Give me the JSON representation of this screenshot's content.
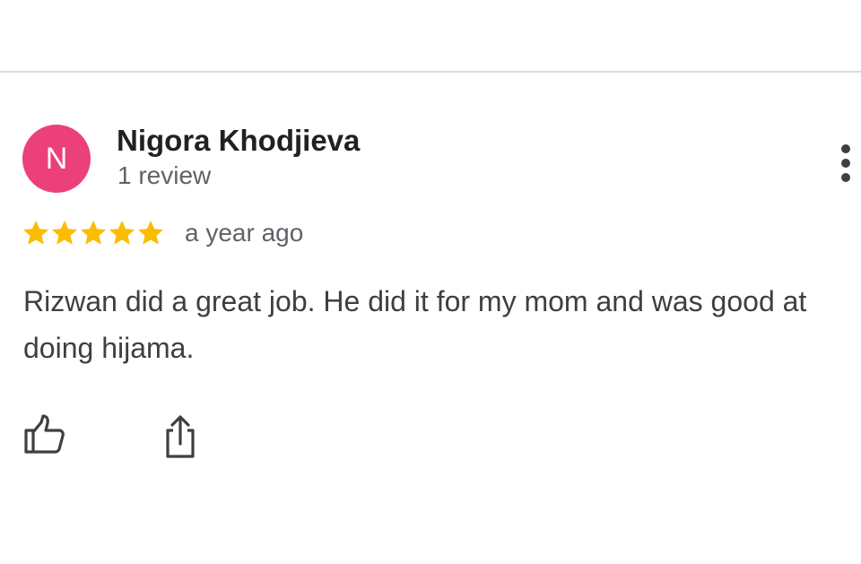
{
  "reviewer": {
    "initial": "N",
    "name": "Nigora Khodjieva",
    "review_count": "1 review",
    "avatar_color": "#ec407a"
  },
  "review": {
    "rating": 5,
    "max_rating": 5,
    "date": "a year ago",
    "text": "Rizwan did a great job. He did it for my mom and was good at doing hijama.",
    "star_color": "#fbbc04"
  },
  "actions": {
    "more_icon": "more-vert-icon",
    "like_icon": "thumb-up-icon",
    "share_icon": "share-icon"
  }
}
